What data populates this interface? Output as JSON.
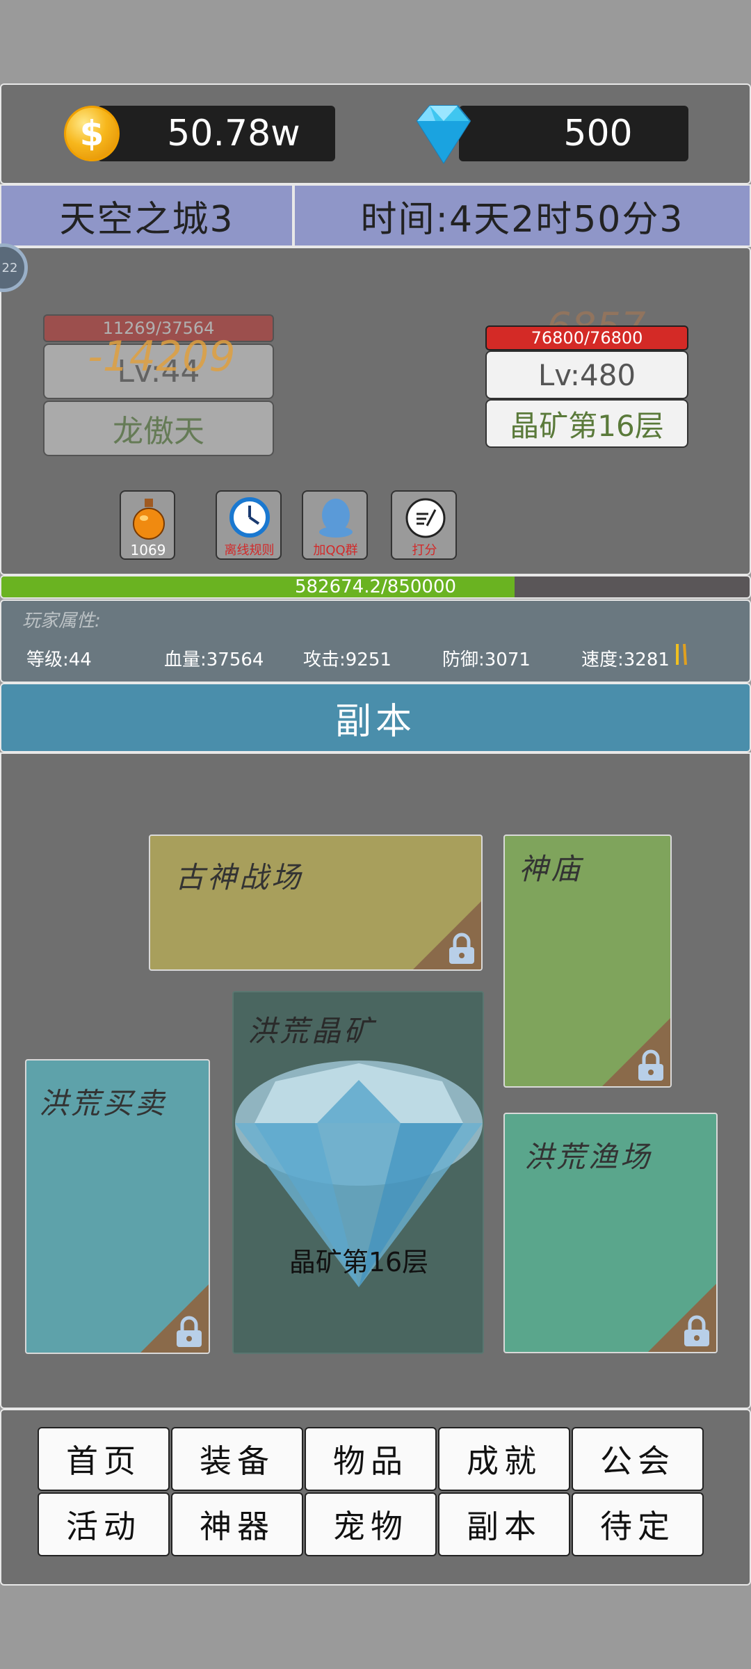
{
  "currency": {
    "gold": "50.78w",
    "gems": "500"
  },
  "header": {
    "location": "天空之城3",
    "time": "时间:4天2时50分3"
  },
  "battle": {
    "side_badge": "22",
    "player": {
      "hp": "11269/37564",
      "damage": "-14209",
      "level": "Lv:44",
      "name": "龙傲天"
    },
    "enemy": {
      "damage": "6857",
      "hp": "76800/76800",
      "level": "Lv:480",
      "name": "晶矿第16层"
    },
    "tools": [
      {
        "label": "1069"
      },
      {
        "label": "离线规则"
      },
      {
        "label": "加QQ群"
      },
      {
        "label": "打分"
      }
    ]
  },
  "experience": {
    "text": "582674.2/850000",
    "progress": 0.6855
  },
  "attributes": {
    "title": "玩家属性:",
    "level": "等级:44",
    "hp": "血量:37564",
    "attack": "攻击:9251",
    "defense": "防御:3071",
    "speed": "速度:3281"
  },
  "section": {
    "title": "副本"
  },
  "dungeons": {
    "ancient": {
      "title": "古神战场"
    },
    "temple": {
      "title": "神庙"
    },
    "mine": {
      "title": "洪荒晶矿",
      "floor": "晶矿第16层"
    },
    "trade": {
      "title": "洪荒买卖"
    },
    "fishing": {
      "title": "洪荒渔场"
    }
  },
  "nav": {
    "row1": [
      "首页",
      "装备",
      "物品",
      "成就",
      "公会"
    ],
    "row2": [
      "活动",
      "神器",
      "宠物",
      "副本",
      "待定"
    ]
  },
  "colors": {
    "exp_fill": "#6ab321",
    "enemy_hp": "#d42a26",
    "section_bar": "#4a8eab",
    "header_bar": "#8f96c8"
  }
}
